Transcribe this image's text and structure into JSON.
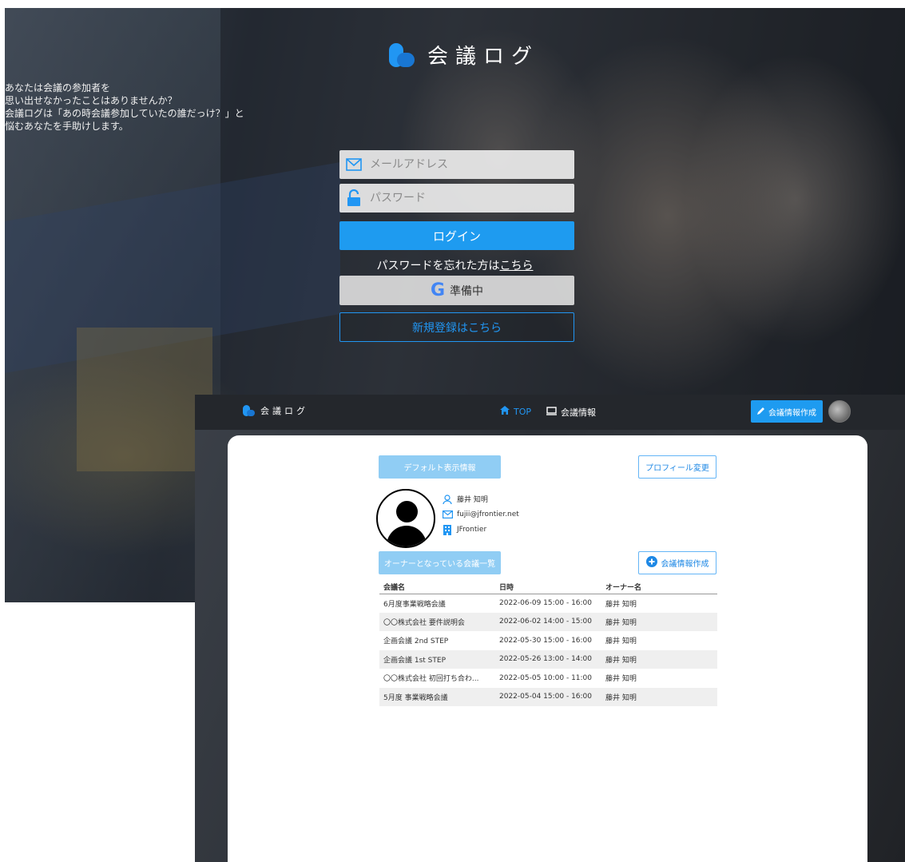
{
  "login": {
    "logo_text": "会議ログ",
    "description": [
      "あなたは会議の参加者を",
      "思い出せなかったことはありませんか？",
      "会議ログは「あの時会議参加していたの誰だっけ？」と",
      "悩むあなたを手助けします。"
    ],
    "email_placeholder": "メールアドレス",
    "password_placeholder": "パスワード",
    "login_button": "ログイン",
    "forgot_prefix": "パスワードを忘れた方は",
    "forgot_link": "こちら",
    "google_button": "準備中",
    "google_glyph": "G",
    "register_button": "新規登録はこちら",
    "colors": {
      "primary": "#1e9bf0",
      "google_blue": "#4285f4"
    }
  },
  "dashboard": {
    "nav": {
      "logo_text": "会議ログ",
      "top_label": "TOP",
      "info_label": "会議情報",
      "create_button": "会議情報作成"
    },
    "default_info_label": "デフォルト表示情報",
    "profile_change_button": "プロフィール変更",
    "profile": {
      "name": "藤井 知明",
      "email": "fujii@jfrontier.net",
      "company": "JFrontier"
    },
    "owner_list_label": "オーナーとなっている会議一覧",
    "create_meeting_button": "会議情報作成",
    "table": {
      "headers": [
        "会議名",
        "日時",
        "オーナー名"
      ],
      "rows": [
        [
          "6月度事業戦略会議",
          "2022-06-09 15:00 - 16:00",
          "藤井 知明"
        ],
        [
          "〇〇株式会社 要件説明会",
          "2022-06-02 14:00 - 15:00",
          "藤井 知明"
        ],
        [
          "企画会議 2nd STEP",
          "2022-05-30 15:00 - 16:00",
          "藤井 知明"
        ],
        [
          "企画会議 1st STEP",
          "2022-05-26 13:00 - 14:00",
          "藤井 知明"
        ],
        [
          "〇〇株式会社 初回打ち合わ...",
          "2022-05-05 10:00 - 11:00",
          "藤井 知明"
        ],
        [
          "5月度 事業戦略会議",
          "2022-05-04 15:00 - 16:00",
          "藤井 知明"
        ]
      ]
    },
    "icons": [
      "home-icon",
      "screen-icon",
      "pencil-icon",
      "user-icon",
      "mail-icon",
      "building-icon",
      "plus-circle-icon"
    ]
  }
}
